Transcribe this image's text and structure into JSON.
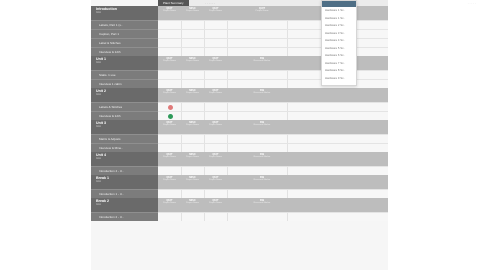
{
  "top_link": "· · · · ·",
  "tabs": [
    {
      "label": "Plant Summary",
      "active": true
    },
    {
      "label": "· · · · · ·",
      "active": false
    }
  ],
  "dropdown": {
    "items": [
      "Hardware 1 Sc..",
      "Hardware 1 Sc..",
      "Hardware 2 Sc..",
      "Hardware 3 Sc..",
      "Hardware 4 Sc..",
      "Hardware 5 Sc..",
      "Hardware 6 Sc..",
      "Hardware 7 Sc..",
      "Hardware 8 Sc..",
      "Hardware 9 Sc.."
    ]
  },
  "groups": [
    {
      "title": "Introduction",
      "subtitle": "Intro",
      "rows": [
        "Labels, Part 1 (s..",
        "Caption, Part 1",
        "Label & Stitches",
        "Interview & 12th"
      ],
      "columns": [
        {
          "h1": "QUIT",
          "h2": "Proper Name"
        },
        {
          "h1": "MISC",
          "h2": "Proper Name"
        },
        {
          "h1": "QUIT",
          "h2": "Proper Name"
        },
        {
          "h1": "QUIT",
          "h2": "Proper Name"
        }
      ]
    },
    {
      "title": "Unit 1",
      "subtitle": "Intro",
      "rows": [
        "Statis. 1 use",
        "Interview 1 cabin"
      ],
      "columns": [
        {
          "h1": "QUIT",
          "h2": "Proper Name"
        },
        {
          "h1": "MISC",
          "h2": "Proper Name"
        },
        {
          "h1": "QUIT",
          "h2": "Proper Name"
        },
        {
          "h1": "FIB",
          "h2": "Reserved Marker"
        }
      ]
    },
    {
      "title": "Unit 2",
      "subtitle": "Intro",
      "rows": [
        "Labels & Stitches",
        "Interview & 12th"
      ],
      "columns": [
        {
          "h1": "QUIT",
          "h2": "Proper Name"
        },
        {
          "h1": "MISC",
          "h2": "Proper Name"
        },
        {
          "h1": "QUIT",
          "h2": "Proper Name"
        },
        {
          "h1": "FIB",
          "h2": "Reserved Marker"
        }
      ],
      "statuses": [
        "#e07a7a",
        "#2e9a5a"
      ]
    },
    {
      "title": "Unit 3",
      "subtitle": "Intro",
      "rows": [
        "Matrix & Adjusts",
        "Interview & Mine.."
      ],
      "columns": [
        {
          "h1": "QUIT",
          "h2": "Proper Name"
        },
        {
          "h1": "MISC",
          "h2": "Proper Name"
        },
        {
          "h1": "QUIT",
          "h2": "Proper Name"
        },
        {
          "h1": "FIB",
          "h2": "Reserved Marker"
        }
      ]
    },
    {
      "title": "Unit 4",
      "subtitle": "Intro",
      "rows": [
        "Introduction 4 - U.."
      ],
      "columns": [
        {
          "h1": "QUIT",
          "h2": "Proper Name"
        },
        {
          "h1": "MISC",
          "h2": "Proper Name"
        },
        {
          "h1": "QUIT",
          "h2": "Proper Name"
        },
        {
          "h1": "FIB",
          "h2": "Reserved Marker"
        }
      ]
    },
    {
      "title": "Break 1",
      "subtitle": "Intro",
      "rows": [
        "Introduction 1 - U.."
      ],
      "columns": [
        {
          "h1": "QUIT",
          "h2": "Proper Name"
        },
        {
          "h1": "MISC",
          "h2": "Proper Name"
        },
        {
          "h1": "QUIT",
          "h2": "Proper Name"
        },
        {
          "h1": "FIB",
          "h2": "Reserved Marker"
        }
      ]
    },
    {
      "title": "Break 2",
      "subtitle": "Intro",
      "rows": [
        "Introduction 2 - U.."
      ],
      "columns": [
        {
          "h1": "QUIT",
          "h2": "Proper Name"
        },
        {
          "h1": "MISC",
          "h2": "Proper Name"
        },
        {
          "h1": "QUIT",
          "h2": "Proper Name"
        },
        {
          "h1": "FIB",
          "h2": "Reserved Marker"
        }
      ]
    }
  ],
  "colors": {
    "status_red": "#e07a7a",
    "status_green": "#2e9a5a",
    "dropdown_header": "#4f6f86"
  }
}
